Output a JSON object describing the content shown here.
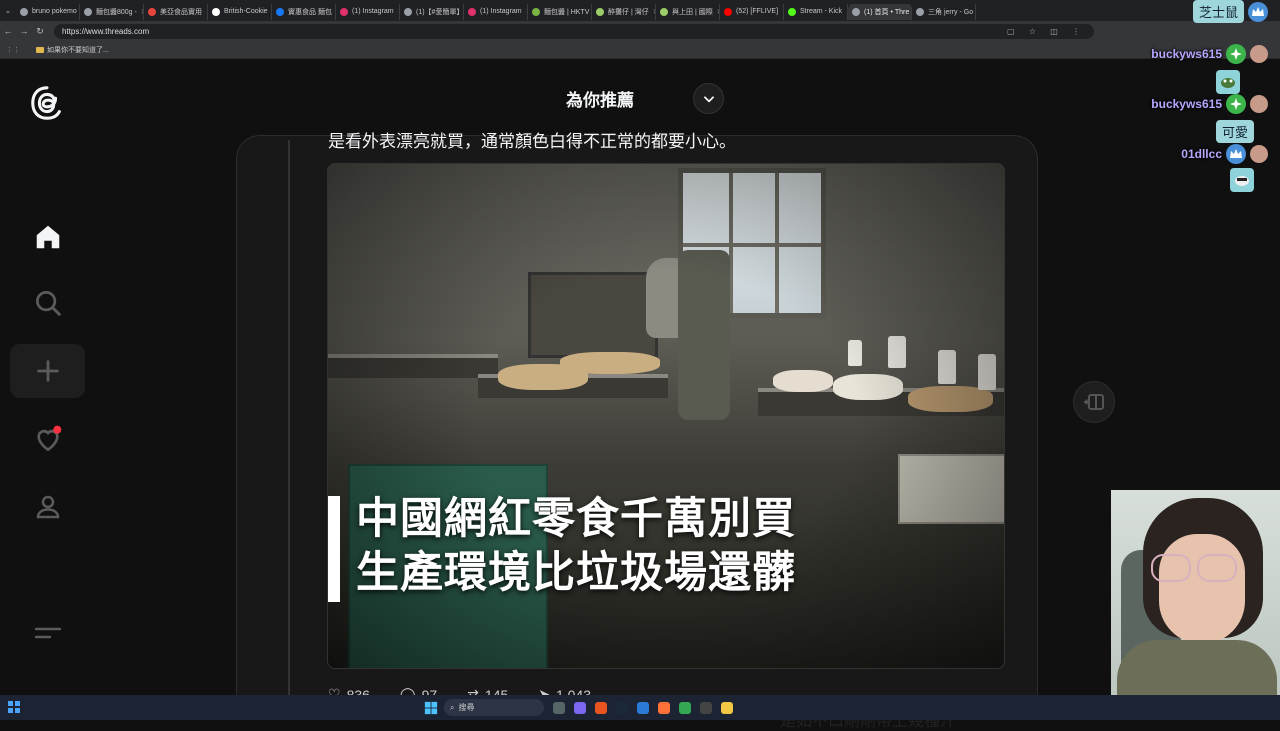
{
  "browser": {
    "tabs": [
      {
        "title": "bruno pokemo",
        "color": "#9aa0a6",
        "active": false
      },
      {
        "title": "麵包醬800g -",
        "color": "#9aa0a6",
        "active": false
      },
      {
        "title": "美亞食品實用",
        "color": "#e8453c",
        "active": false
      },
      {
        "title": "British-Cookie",
        "color": "#ffffff",
        "active": false
      },
      {
        "title": "實惠食品 麵包",
        "color": "#1877f2",
        "active": false
      },
      {
        "title": "(1) Instagram",
        "color": "#e1306c",
        "active": false
      },
      {
        "title": "(1)【#愛簡單】",
        "color": "#9aa0a6",
        "active": false
      },
      {
        "title": "(1) Instagram",
        "color": "#e1306c",
        "active": false
      },
      {
        "title": "麵包醬 | HKTV",
        "color": "#7cb342",
        "active": false
      },
      {
        "title": "醉攤仔 | 灣仔",
        "color": "#9ccc65",
        "active": false
      },
      {
        "title": "與上田 | 國際",
        "color": "#9ccc65",
        "active": false
      },
      {
        "title": "(52) [FFLIVE]",
        "color": "#ff0000",
        "active": false
      },
      {
        "title": "Stream - Kick",
        "color": "#53fc18",
        "active": false
      },
      {
        "title": "(1) 首頁 • Thre",
        "color": "#9aa0a6",
        "active": true
      },
      {
        "title": "三角 jerry - Go",
        "color": "#9aa0a6",
        "active": false
      }
    ],
    "url": "https://www.threads.com",
    "bookmark": "如果你不要知道了..."
  },
  "threads": {
    "feed_title": "為你推薦",
    "post_text": "是看外表漂亮就買，通常顏色白得不正常的都要小心。",
    "image_headline_1": "中國網紅零食千萬別買",
    "image_headline_2": "生產環境比垃圾場還髒",
    "actions": {
      "likes": "836",
      "comments": "97",
      "reposts": "145",
      "shares": "1,043"
    },
    "accent_color": "#ff3040"
  },
  "chat": [
    {
      "name": "",
      "message": "芝士鼠"
    },
    {
      "name": "buckyws615",
      "message": ""
    },
    {
      "name": "buckyws615",
      "message": "可愛"
    },
    {
      "name": "01dllcc",
      "message": ""
    }
  ],
  "taskbar": {
    "search_placeholder": "搜尋"
  },
  "subtitle": "是如不口剛剛帶上幾種汁"
}
